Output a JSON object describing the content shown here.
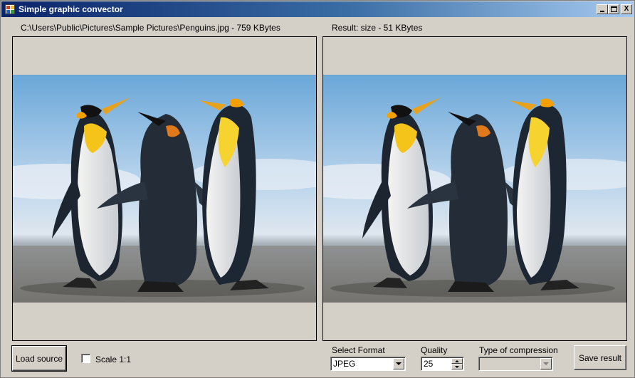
{
  "window": {
    "title": "Simple graphic convector",
    "minimize_label": "_",
    "maximize_label": "□",
    "close_label": "X"
  },
  "source": {
    "label": "C:\\Users\\Public\\Pictures\\Sample Pictures\\Penguins.jpg - 759 KBytes"
  },
  "result": {
    "label": "Result: size - 51 KBytes"
  },
  "controls": {
    "load_label": "Load source",
    "scale_label": "Scale 1:1",
    "scale_checked": false,
    "format_label": "Select Format",
    "format_value": "JPEG",
    "quality_label": "Quality",
    "quality_value": "25",
    "compression_label": "Type of compression",
    "compression_value": "",
    "save_label": "Save result"
  },
  "icons": {
    "app": "app-icon",
    "combo_arrow": "chevron-down-icon",
    "spin_up": "spin-up-icon",
    "spin_down": "spin-down-icon"
  }
}
